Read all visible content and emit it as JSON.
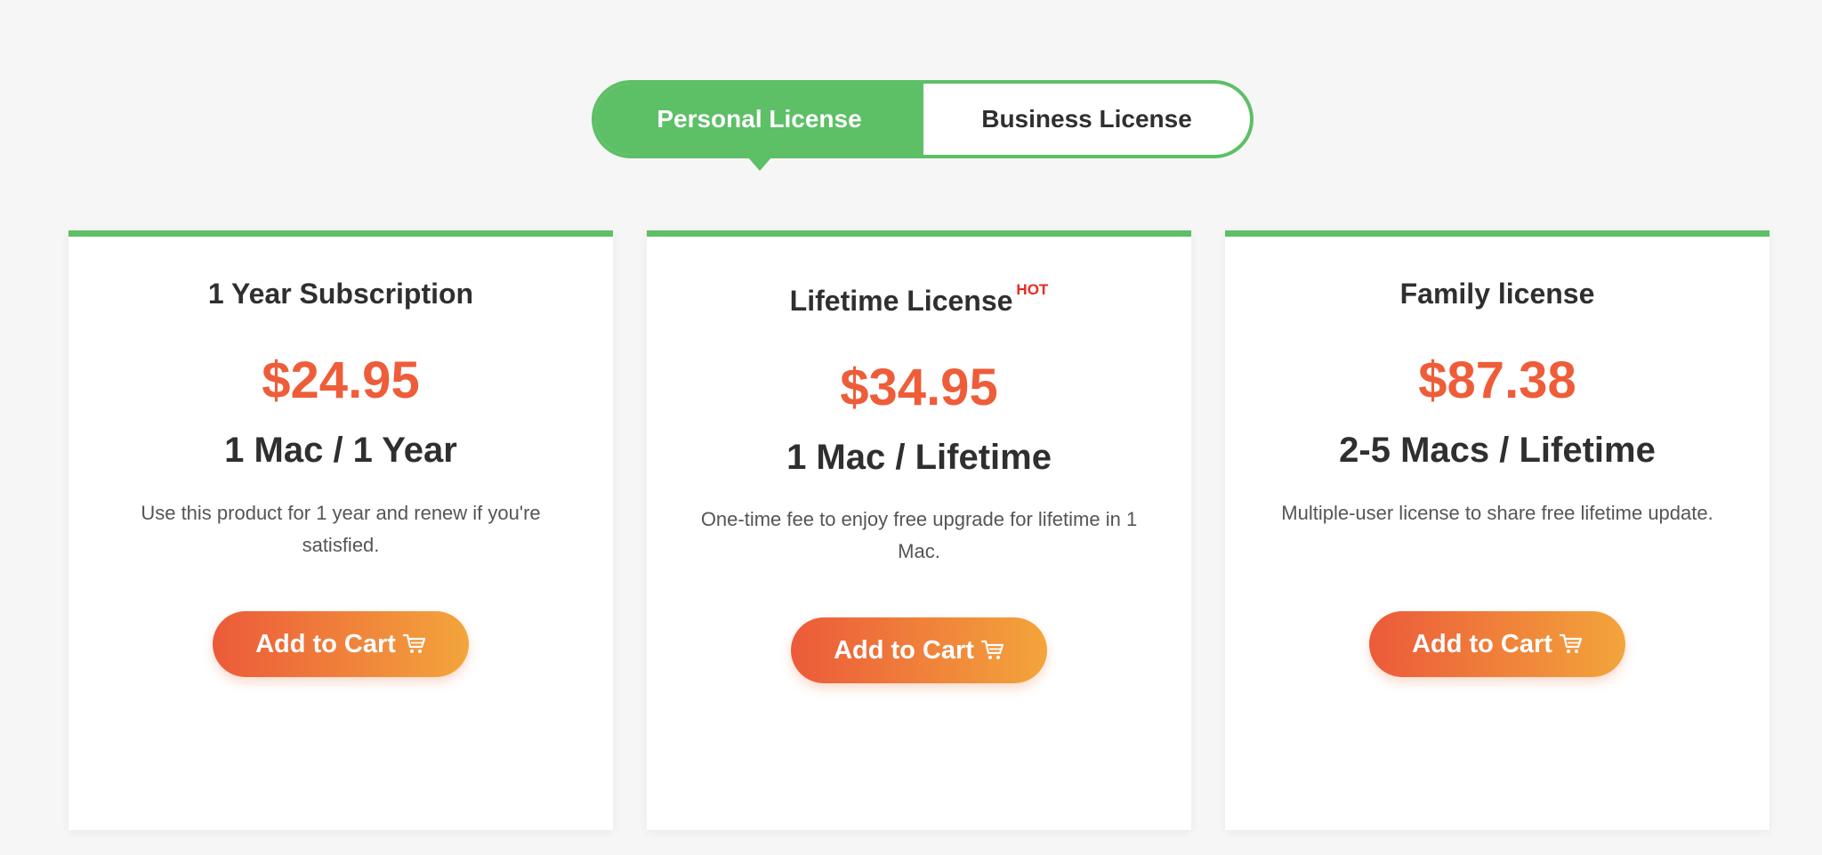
{
  "license_toggle": {
    "personal_label": "Personal License",
    "business_label": "Business License",
    "selected": "Personal License"
  },
  "cards": [
    {
      "title": "1 Year Subscription",
      "badge": "",
      "price": "$24.95",
      "term": "1 Mac / 1 Year",
      "description": "Use this product for 1 year and renew if you're satisfied.",
      "button_label": "Add to Cart"
    },
    {
      "title": "Lifetime License",
      "badge": "HOT",
      "price": "$34.95",
      "term": "1 Mac / Lifetime",
      "description": "One-time fee to enjoy free upgrade for lifetime in 1 Mac.",
      "button_label": "Add to Cart"
    },
    {
      "title": "Family license",
      "badge": "",
      "price": "$87.38",
      "term": "2-5 Macs / Lifetime",
      "description": "Multiple-user license to share free lifetime update.",
      "button_label": "Add to Cart"
    }
  ],
  "icons": {
    "cart": "cart-icon"
  },
  "colors": {
    "accent_green": "#5dbf66",
    "price_orange": "#ee5d39",
    "button_gradient_start": "#ec5a3a",
    "button_gradient_end": "#f3a53b",
    "hot_red": "#e8291f"
  }
}
